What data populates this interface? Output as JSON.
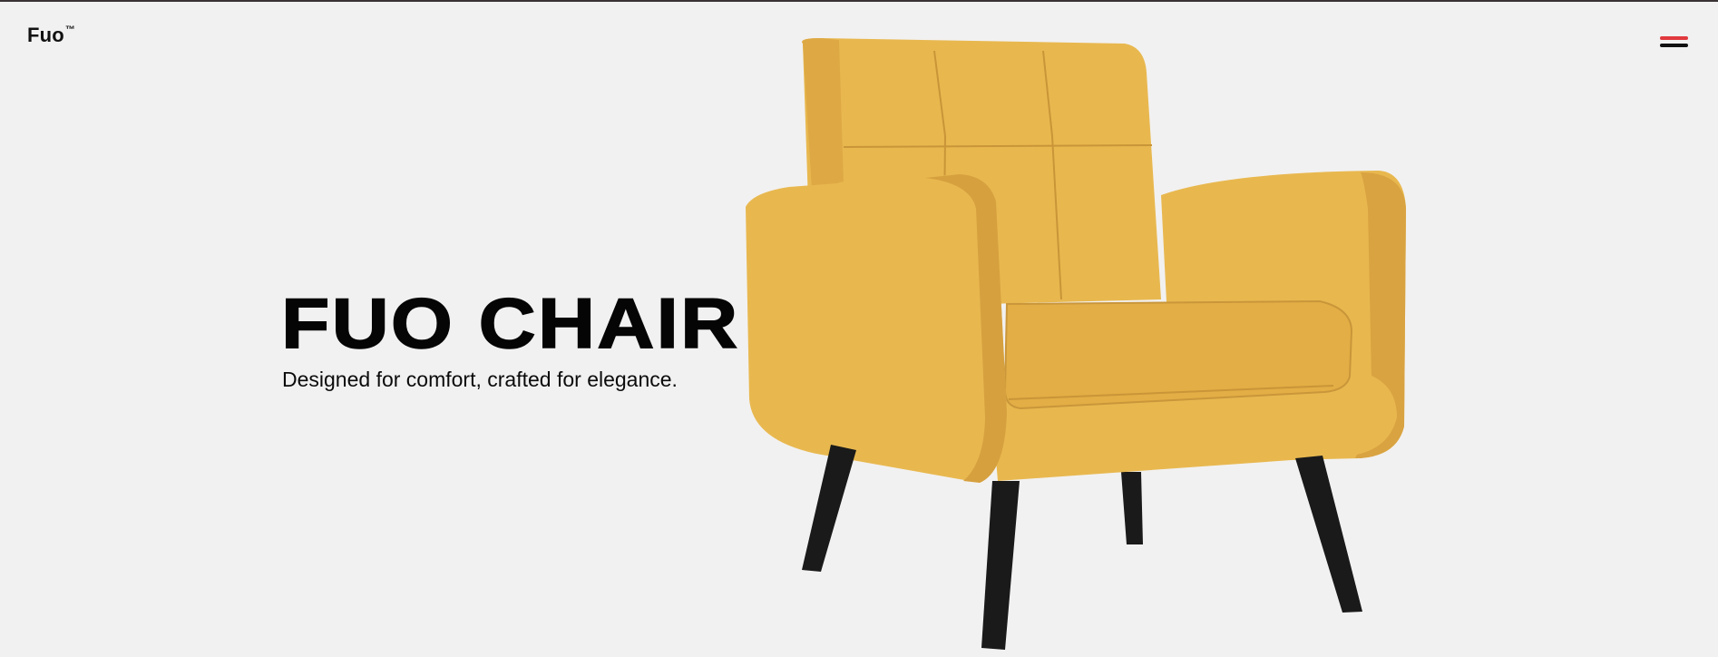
{
  "header": {
    "logo_text": "Fuo",
    "logo_mark": "™",
    "menu_icon": "hamburger-menu-icon",
    "menu_colors": [
      "#e0393e",
      "#111111"
    ]
  },
  "hero": {
    "title": "FUO CHAIR",
    "subtitle": "Designed for comfort, crafted for elegance.",
    "image": "yellow-armchair",
    "colors": {
      "upholstery": "#e8b84f",
      "legs": "#1a1a1a",
      "background": "#f2f1f1"
    }
  }
}
